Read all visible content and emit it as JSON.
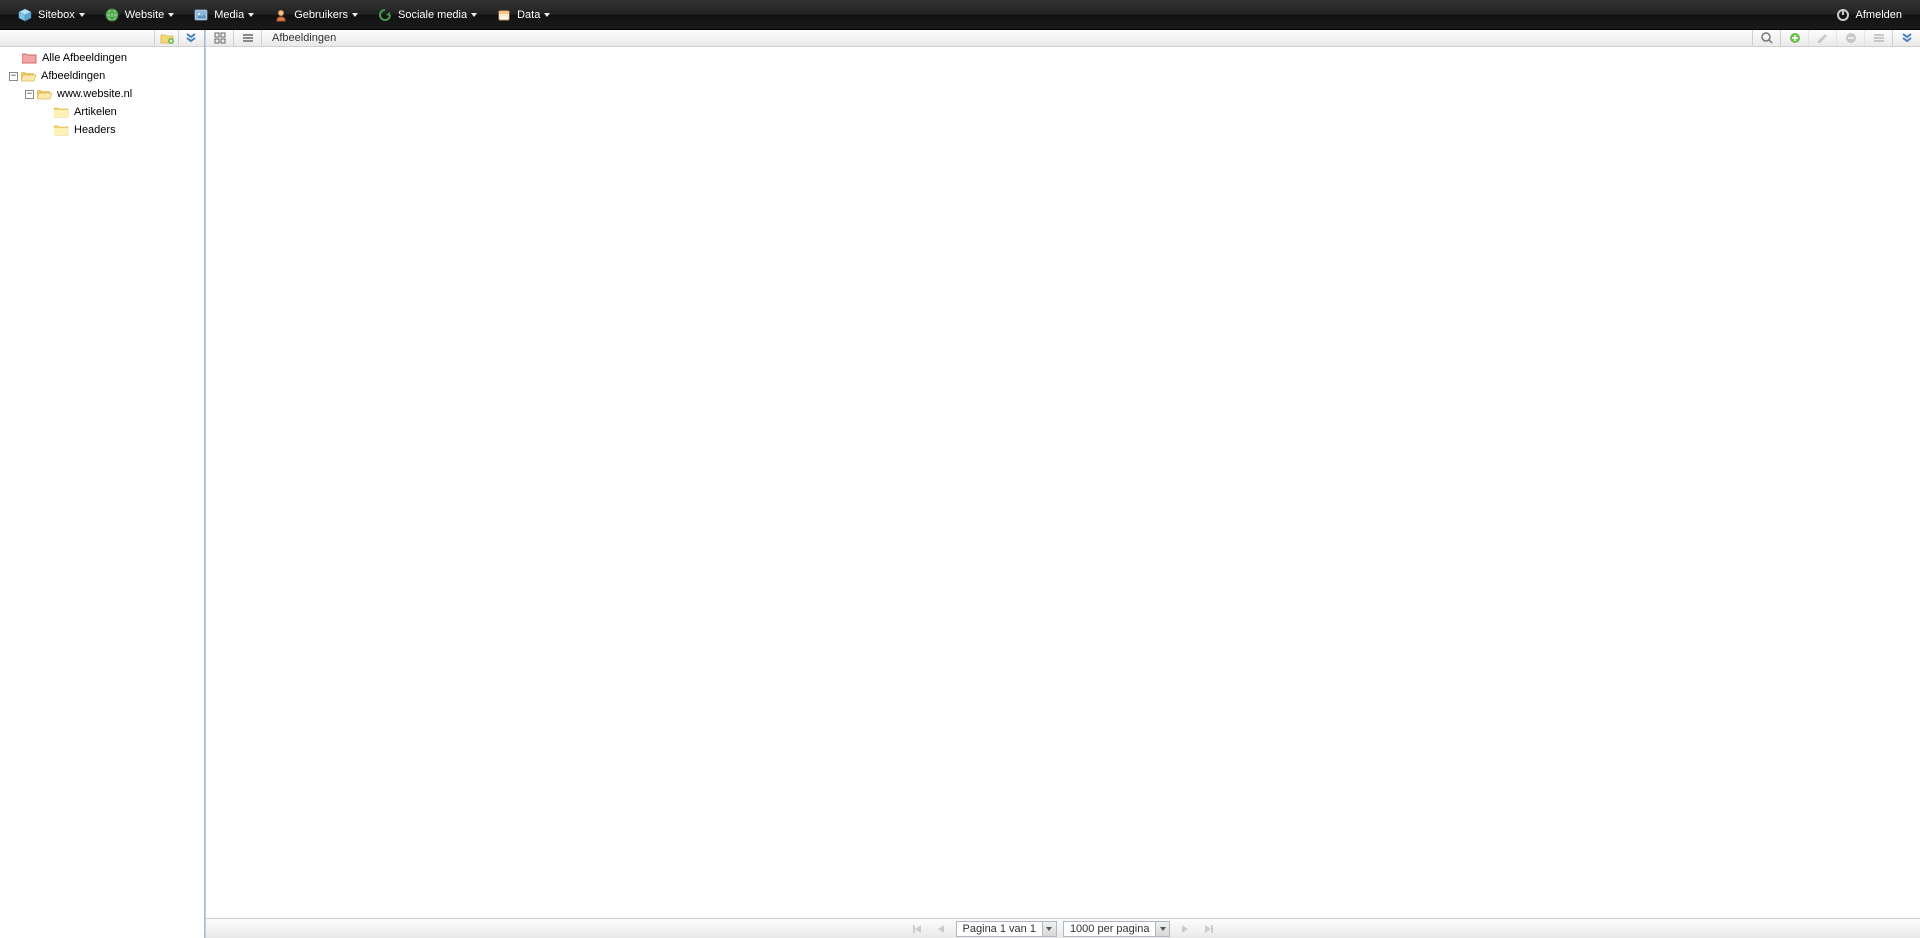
{
  "topbar": {
    "menus": [
      {
        "label": "Sitebox",
        "icon": "cube"
      },
      {
        "label": "Website",
        "icon": "globe"
      },
      {
        "label": "Media",
        "icon": "image"
      },
      {
        "label": "Gebruikers",
        "icon": "user"
      },
      {
        "label": "Sociale media",
        "icon": "refresh"
      },
      {
        "label": "Data",
        "icon": "database"
      }
    ],
    "logout_label": "Afmelden"
  },
  "tree": {
    "nodes": [
      {
        "label": "Alle Afbeeldingen",
        "depth": 0,
        "expander": "none",
        "icon": "folder-red"
      },
      {
        "label": "Afbeeldingen",
        "depth": 0,
        "expander": "minus",
        "icon": "folder-open"
      },
      {
        "label": "www.website.nl",
        "depth": 1,
        "expander": "minus",
        "icon": "folder-open"
      },
      {
        "label": "Artikelen",
        "depth": 2,
        "expander": "space",
        "icon": "folder-closed"
      },
      {
        "label": "Headers",
        "depth": 2,
        "expander": "space",
        "icon": "folder-closed"
      }
    ]
  },
  "main": {
    "breadcrumb": "Afbeeldingen"
  },
  "status": {
    "page_text": "Pagina 1 van 1",
    "perpage_text": "1000 per pagina"
  }
}
